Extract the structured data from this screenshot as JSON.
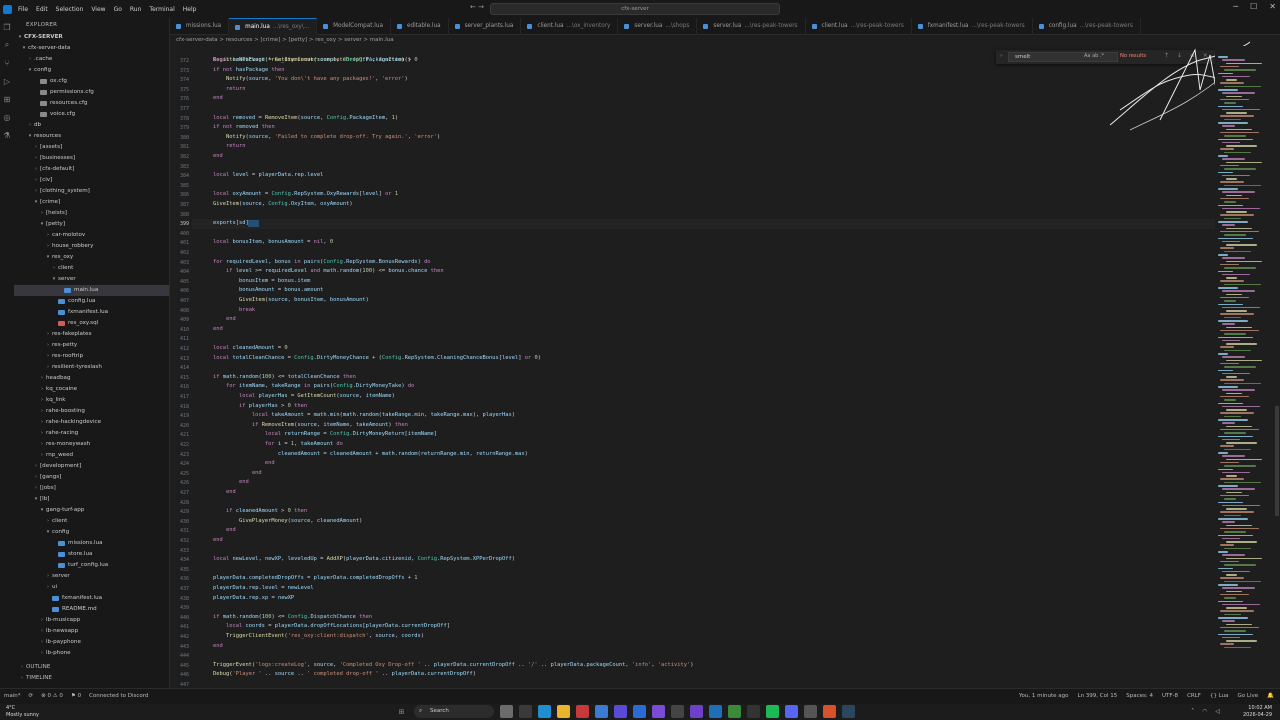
{
  "titlebar": {
    "menu": [
      "File",
      "Edit",
      "Selection",
      "View",
      "Go",
      "Run",
      "Terminal",
      "Help"
    ],
    "search_text": "cfx-server",
    "colors": {
      "accent": "#0e7ad1"
    }
  },
  "sidebar": {
    "header": "EXPLORER",
    "root": "CFX-SERVER",
    "items": [
      {
        "label": "cfx-server-data",
        "depth": 1,
        "kind": "folder-open"
      },
      {
        "label": ".cache",
        "depth": 2,
        "kind": "folder"
      },
      {
        "label": "config",
        "depth": 2,
        "kind": "folder-open"
      },
      {
        "label": "ox.cfg",
        "depth": 3,
        "kind": "cfg"
      },
      {
        "label": "permissions.cfg",
        "depth": 3,
        "kind": "cfg"
      },
      {
        "label": "resources.cfg",
        "depth": 3,
        "kind": "cfg"
      },
      {
        "label": "voice.cfg",
        "depth": 3,
        "kind": "cfg"
      },
      {
        "label": "db",
        "depth": 2,
        "kind": "folder"
      },
      {
        "label": "resources",
        "depth": 2,
        "kind": "folder-open"
      },
      {
        "label": "[assets]",
        "depth": 3,
        "kind": "folder"
      },
      {
        "label": "[businesses]",
        "depth": 3,
        "kind": "folder"
      },
      {
        "label": "[cfx-default]",
        "depth": 3,
        "kind": "folder"
      },
      {
        "label": "[civ]",
        "depth": 3,
        "kind": "folder"
      },
      {
        "label": "[clothing_system]",
        "depth": 3,
        "kind": "folder"
      },
      {
        "label": "[crime]",
        "depth": 3,
        "kind": "folder-open"
      },
      {
        "label": "[heists]",
        "depth": 4,
        "kind": "folder"
      },
      {
        "label": "[petty]",
        "depth": 4,
        "kind": "folder-open"
      },
      {
        "label": "car-molotov",
        "depth": 5,
        "kind": "folder"
      },
      {
        "label": "house_robbery",
        "depth": 5,
        "kind": "folder"
      },
      {
        "label": "res_oxy",
        "depth": 5,
        "kind": "folder-open"
      },
      {
        "label": "client",
        "depth": 6,
        "kind": "folder"
      },
      {
        "label": "server",
        "depth": 6,
        "kind": "folder-open"
      },
      {
        "label": "main.lua",
        "depth": 7,
        "kind": "lua",
        "selected": true
      },
      {
        "label": "config.lua",
        "depth": 6,
        "kind": "lua"
      },
      {
        "label": "fxmanifest.lua",
        "depth": 6,
        "kind": "lua"
      },
      {
        "label": "res_oxy.sql",
        "depth": 6,
        "kind": "sql"
      },
      {
        "label": "res-fakeplates",
        "depth": 5,
        "kind": "folder"
      },
      {
        "label": "res-petty",
        "depth": 5,
        "kind": "folder"
      },
      {
        "label": "res-rooftrip",
        "depth": 5,
        "kind": "folder"
      },
      {
        "label": "resilient-tyreslash",
        "depth": 5,
        "kind": "folder"
      },
      {
        "label": "headbag",
        "depth": 4,
        "kind": "folder"
      },
      {
        "label": "kq_cocaine",
        "depth": 4,
        "kind": "folder"
      },
      {
        "label": "kq_link",
        "depth": 4,
        "kind": "folder"
      },
      {
        "label": "rahe-boosting",
        "depth": 4,
        "kind": "folder"
      },
      {
        "label": "rahe-hackingdevice",
        "depth": 4,
        "kind": "folder"
      },
      {
        "label": "rahe-racing",
        "depth": 4,
        "kind": "folder"
      },
      {
        "label": "res-moneywash",
        "depth": 4,
        "kind": "folder"
      },
      {
        "label": "rnp_weed",
        "depth": 4,
        "kind": "folder"
      },
      {
        "label": "[development]",
        "depth": 3,
        "kind": "folder"
      },
      {
        "label": "[gangs]",
        "depth": 3,
        "kind": "folder"
      },
      {
        "label": "[jobs]",
        "depth": 3,
        "kind": "folder"
      },
      {
        "label": "[lb]",
        "depth": 3,
        "kind": "folder-open"
      },
      {
        "label": "gang-turf-app",
        "depth": 4,
        "kind": "folder-open"
      },
      {
        "label": "client",
        "depth": 5,
        "kind": "folder"
      },
      {
        "label": "config",
        "depth": 5,
        "kind": "folder-open"
      },
      {
        "label": "missions.lua",
        "depth": 6,
        "kind": "lua"
      },
      {
        "label": "store.lua",
        "depth": 6,
        "kind": "lua"
      },
      {
        "label": "turf_config.lua",
        "depth": 6,
        "kind": "lua"
      },
      {
        "label": "server",
        "depth": 5,
        "kind": "folder"
      },
      {
        "label": "ui",
        "depth": 5,
        "kind": "folder"
      },
      {
        "label": "fxmanifest.lua",
        "depth": 5,
        "kind": "lua"
      },
      {
        "label": "README.md",
        "depth": 5,
        "kind": "md"
      },
      {
        "label": "lb-musicapp",
        "depth": 4,
        "kind": "folder"
      },
      {
        "label": "lb-newsapp",
        "depth": 4,
        "kind": "folder"
      },
      {
        "label": "lb-payphone",
        "depth": 4,
        "kind": "folder"
      },
      {
        "label": "lb-phone",
        "depth": 4,
        "kind": "folder"
      }
    ],
    "bottom": [
      "OUTLINE",
      "TIMELINE"
    ]
  },
  "tabs": [
    {
      "name": "missions.lua",
      "sub": ""
    },
    {
      "name": "main.lua",
      "sub": "...\\res_oxy\\...",
      "active": true
    },
    {
      "name": "ModelCompat.lua",
      "sub": ""
    },
    {
      "name": "editable.lua",
      "sub": ""
    },
    {
      "name": "server_plants.lua",
      "sub": ""
    },
    {
      "name": "client.lua",
      "sub": "...\\ox_inventory"
    },
    {
      "name": "server.lua",
      "sub": "...\\shops"
    },
    {
      "name": "server.lua",
      "sub": "...\\res-peak-towers"
    },
    {
      "name": "client.lua",
      "sub": "...\\res-peak-towers"
    },
    {
      "name": "fxmanifest.lua",
      "sub": "...\\res-peak-towers"
    },
    {
      "name": "config.lua",
      "sub": "...\\res-peak-towers"
    }
  ],
  "breadcrumb": "cfx-server-data > resources > [crime] > [petty] > res_oxy > server > main.lua",
  "editor": {
    "header_line": "RegisterNetEvent('res_oxy:server:completeDropOff', function()",
    "lines": [
      {
        "n": "372",
        "t": "    local hasPackage = GetItemCount(source, Config.PackageItem) > 0"
      },
      {
        "n": "373",
        "t": "    if not hasPackage then"
      },
      {
        "n": "374",
        "t": "        Notify(source, 'You don\\'t have any packages!', 'error')"
      },
      {
        "n": "375",
        "t": "        return"
      },
      {
        "n": "376",
        "t": "    end"
      },
      {
        "n": "377",
        "t": ""
      },
      {
        "n": "378",
        "t": "    local removed = RemoveItem(source, Config.PackageItem, 1)"
      },
      {
        "n": "379",
        "t": "    if not removed then"
      },
      {
        "n": "380",
        "t": "        Notify(source, 'Failed to complete drop-off. Try again.', 'error')"
      },
      {
        "n": "381",
        "t": "        return"
      },
      {
        "n": "382",
        "t": "    end"
      },
      {
        "n": "383",
        "t": ""
      },
      {
        "n": "384",
        "t": "    local level = playerData.rep.level"
      },
      {
        "n": "385",
        "t": ""
      },
      {
        "n": "386",
        "t": "    local oxyAmount = Config.RepSystem.OxyRewards[level] or 1"
      },
      {
        "n": "387",
        "t": "    GiveItem(source, Config.OxyItem, oxyAmount)"
      },
      {
        "n": "388",
        "t": ""
      },
      {
        "n": "399",
        "t": "    exports[sd]",
        "cur": true
      },
      {
        "n": "400",
        "t": ""
      },
      {
        "n": "401",
        "t": "    local bonusItem, bonusAmount = nil, 0"
      },
      {
        "n": "402",
        "t": ""
      },
      {
        "n": "403",
        "t": "    for requiredLevel, bonus in pairs(Config.RepSystem.BonusRewards) do"
      },
      {
        "n": "404",
        "t": "        if level >= requiredLevel and math.random(100) <= bonus.chance then"
      },
      {
        "n": "405",
        "t": "            bonusItem = bonus.item"
      },
      {
        "n": "406",
        "t": "            bonusAmount = bonus.amount"
      },
      {
        "n": "407",
        "t": "            GiveItem(source, bonusItem, bonusAmount)"
      },
      {
        "n": "408",
        "t": "            break"
      },
      {
        "n": "409",
        "t": "        end"
      },
      {
        "n": "410",
        "t": "    end"
      },
      {
        "n": "411",
        "t": ""
      },
      {
        "n": "412",
        "t": "    local cleanedAmount = 0"
      },
      {
        "n": "413",
        "t": "    local totalCleanChance = Config.DirtyMoneyChance + (Config.RepSystem.CleaningChanceBonus[level] or 0)"
      },
      {
        "n": "414",
        "t": ""
      },
      {
        "n": "415",
        "t": "    if math.random(100) <= totalCleanChance then"
      },
      {
        "n": "416",
        "t": "        for itemName, takeRange in pairs(Config.DirtyMoneyTake) do"
      },
      {
        "n": "417",
        "t": "            local playerHas = GetItemCount(source, itemName)"
      },
      {
        "n": "418",
        "t": "            if playerHas > 0 then"
      },
      {
        "n": "419",
        "t": "                local takeAmount = math.min(math.random(takeRange.min, takeRange.max), playerHas)"
      },
      {
        "n": "420",
        "t": "                if RemoveItem(source, itemName, takeAmount) then"
      },
      {
        "n": "421",
        "t": "                    local returnRange = Config.DirtyMoneyReturn[itemName]"
      },
      {
        "n": "422",
        "t": "                    for i = 1, takeAmount do"
      },
      {
        "n": "423",
        "t": "                        cleanedAmount = cleanedAmount + math.random(returnRange.min, returnRange.max)"
      },
      {
        "n": "424",
        "t": "                    end"
      },
      {
        "n": "425",
        "t": "                end"
      },
      {
        "n": "426",
        "t": "            end"
      },
      {
        "n": "427",
        "t": "        end"
      },
      {
        "n": "428",
        "t": ""
      },
      {
        "n": "429",
        "t": "        if cleanedAmount > 0 then"
      },
      {
        "n": "430",
        "t": "            GivePlayerMoney(source, cleanedAmount)"
      },
      {
        "n": "431",
        "t": "        end"
      },
      {
        "n": "432",
        "t": "    end"
      },
      {
        "n": "433",
        "t": ""
      },
      {
        "n": "434",
        "t": "    local newLevel, newXP, leveledUp = AddXP(playerData.citizenid, Config.RepSystem.XPPerDropOff)"
      },
      {
        "n": "435",
        "t": ""
      },
      {
        "n": "436",
        "t": "    playerData.completedDropOffs = playerData.completedDropOffs + 1"
      },
      {
        "n": "437",
        "t": "    playerData.rep.level = newLevel"
      },
      {
        "n": "438",
        "t": "    playerData.rep.xp = newXP"
      },
      {
        "n": "439",
        "t": ""
      },
      {
        "n": "440",
        "t": "    if math.random(100) <= Config.DispatchChance then"
      },
      {
        "n": "441",
        "t": "        local coords = playerData.dropOffLocations[playerData.currentDropOff]"
      },
      {
        "n": "442",
        "t": "        TriggerClientEvent('res_oxy:client:dispatch', source, coords)"
      },
      {
        "n": "443",
        "t": "    end"
      },
      {
        "n": "444",
        "t": ""
      },
      {
        "n": "445",
        "t": "    TriggerEvent('logs:createLog', source, 'Completed Oxy Drop-off ' .. playerData.currentDropOff .. '/' .. playerData.packageCount, 'info', 'activity')"
      },
      {
        "n": "446",
        "t": "    Debug('Player ' .. source .. ' completed drop-off ' .. playerData.currentDropOff)"
      },
      {
        "n": "447",
        "t": ""
      },
      {
        "n": "448",
        "t": "    if leveledUp then"
      }
    ]
  },
  "find": {
    "value": "smelt",
    "options": "Aa ab .*",
    "result": "No results",
    "buttons": "↑ ↓ ≡ ×"
  },
  "statusbar": {
    "left": [
      "main*",
      "⟳",
      "⊗ 0  ⚠ 0",
      "⚑ 0",
      "Connected to Discord"
    ],
    "right": [
      "You, 1 minute ago",
      "Ln 399, Col 15",
      "Spaces: 4",
      "UTF-8",
      "CRLF",
      "{} Lua",
      "Go Live",
      "🔔"
    ]
  },
  "taskbar": {
    "weather_temp": "4°C",
    "weather_text": "Mostly sunny",
    "search": "Search",
    "time": "10:02 AM",
    "date": "2026-04-29"
  }
}
